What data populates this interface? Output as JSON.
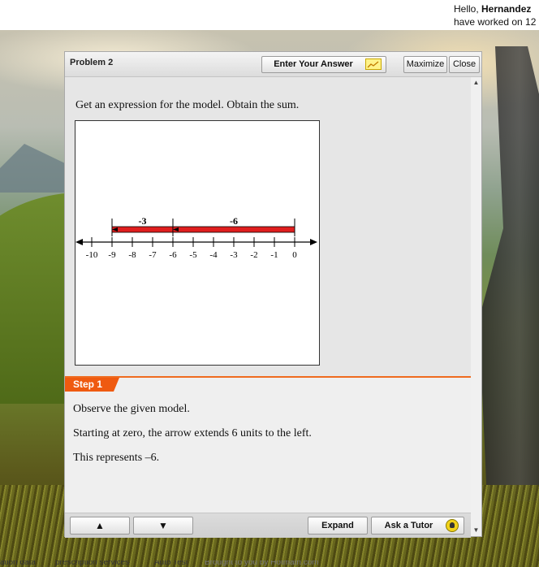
{
  "header": {
    "greeting_prefix": "Hello, ",
    "user_name": "Hernandez",
    "worked_text": "have worked on 12"
  },
  "window": {
    "title": "Problem 2",
    "enter_answer_label": "Enter Your Answer",
    "maximize_label": "Maximize",
    "close_label": "Close"
  },
  "problem": {
    "question": "Get an expression for the model. Obtain the sum."
  },
  "number_line": {
    "ticks": [
      "-10",
      "-9",
      "-8",
      "-7",
      "-6",
      "-5",
      "-4",
      "-3",
      "-2",
      "-1",
      "0"
    ],
    "arrows": [
      {
        "label": "-3",
        "from": -6,
        "to": -9
      },
      {
        "label": "-6",
        "from": 0,
        "to": -6
      }
    ],
    "arrow_color": "#e01e1e"
  },
  "step": {
    "tag": "Step 1",
    "lines": [
      "Observe the given model.",
      "Starting at zero, the arrow extends 6 units to the left.",
      "This represents –6."
    ]
  },
  "bottom": {
    "up_symbol": "▲",
    "down_symbol": "▼",
    "expand_label": "Expand",
    "tutor_label": "Ask a Tutor"
  },
  "footer": {
    "links": [
      "ation data",
      "prescription services",
      "Auto Test",
      "Brought to you by Hotmath.com"
    ]
  },
  "colors": {
    "accent": "#ef5a10",
    "arrow": "#e01e1e"
  }
}
